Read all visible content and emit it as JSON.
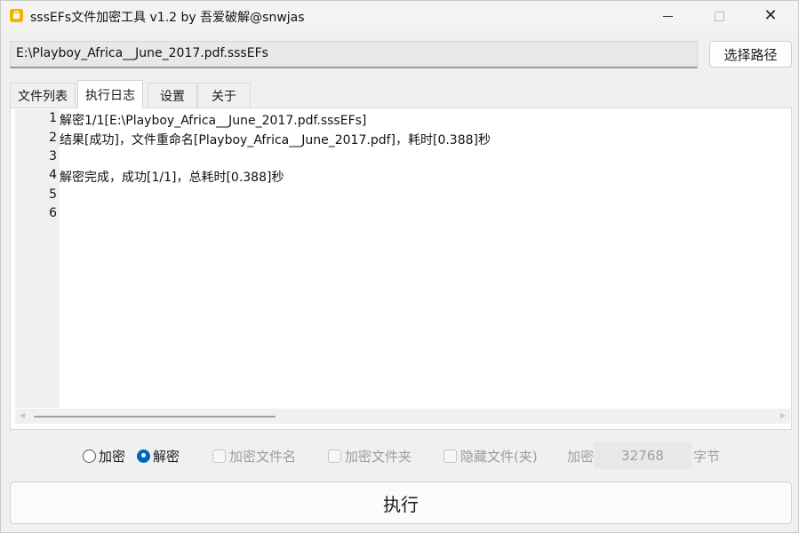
{
  "window": {
    "title": "sssEFs文件加密工具 v1.2 by 吾爱破解@snwjas",
    "icon": "lock-app-icon",
    "controls": {
      "minimize": "minimize",
      "maximize": "maximize",
      "close": "✕"
    }
  },
  "path": {
    "value": "E:\\Playboy_Africa__June_2017.pdf.sssEFs",
    "button_label": "选择路径"
  },
  "tabs": [
    {
      "label": "文件列表",
      "active": false
    },
    {
      "label": "执行日志",
      "active": true
    },
    {
      "label": "设置",
      "active": false
    },
    {
      "label": "关于",
      "active": false
    }
  ],
  "log": {
    "lines": [
      {
        "num": "1",
        "text": "解密1/1[E:\\Playboy_Africa__June_2017.pdf.sssEFs]"
      },
      {
        "num": "2",
        "text": "结果[成功]，文件重命名[Playboy_Africa__June_2017.pdf]，耗时[0.388]秒"
      },
      {
        "num": "3",
        "text": ""
      },
      {
        "num": "4",
        "text": "解密完成，成功[1/1]，总耗时[0.388]秒"
      },
      {
        "num": "5",
        "text": ""
      },
      {
        "num": "6",
        "text": ""
      }
    ]
  },
  "options": {
    "encrypt_label": "加密",
    "decrypt_label": "解密",
    "mode_selected": "解密",
    "encrypt_filename_label": "加密文件名",
    "encrypt_folder_label": "加密文件夹",
    "hidden_files_label": "隐藏文件(夹)",
    "encrypt_size_prefix": "加密",
    "encrypt_size_value": "32768",
    "encrypt_size_unit": "字节"
  },
  "execute_label": "执行",
  "colors": {
    "accent": "#0067c0",
    "disabled_text": "#9e9e9e"
  }
}
